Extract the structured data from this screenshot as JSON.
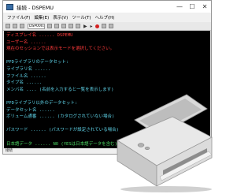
{
  "window": {
    "title": "接続 - DSPEMU",
    "controls": [
      "—",
      "☐",
      "✕"
    ]
  },
  "menu": [
    "ファイル(F)",
    "編集(E)",
    "表示(V)",
    "ツール(T)",
    "ヘルプ(H)"
  ],
  "toolbar": {
    "session_field": "DSP0001"
  },
  "terminal": {
    "lines": [
      {
        "text": "ディスプレイ名 ......  DSPEMU",
        "color": "red"
      },
      {
        "text": "ユーザー名 ......",
        "color": "red"
      },
      {
        "text": "現在のセッションでは表示モードを選択してください。",
        "color": "red"
      },
      {
        "text": "",
        "color": "red"
      },
      {
        "text": "PPDライブラリのデータセット:",
        "color": "cyan"
      },
      {
        "text": "  ライブラリ名 ......",
        "color": "cyan"
      },
      {
        "text": "  ファイル名 ......",
        "color": "cyan"
      },
      {
        "text": "  タイプ名 ......",
        "color": "cyan"
      },
      {
        "text": "  メンバ名 ....              (名前を入力すると一覧を表示します)",
        "color": "cyan"
      },
      {
        "text": "",
        "color": "cyan"
      },
      {
        "text": "PPDライブラリ以外のデータセット:",
        "color": "cyan"
      },
      {
        "text": "  データセット名 ......",
        "color": "cyan"
      },
      {
        "text": "  ボリューム通番 ......      (カタログされていない場合)",
        "color": "cyan"
      },
      {
        "text": "",
        "color": "cyan"
      },
      {
        "text": "パスワード ......            (パスワードが設定されている場合)",
        "color": "cyan"
      },
      {
        "text": "",
        "color": "cyan"
      },
      {
        "text": "日本語データ ...... NO       (YESは日本語データを含む)",
        "color": "green"
      }
    ]
  },
  "status": {
    "text": "接続"
  }
}
